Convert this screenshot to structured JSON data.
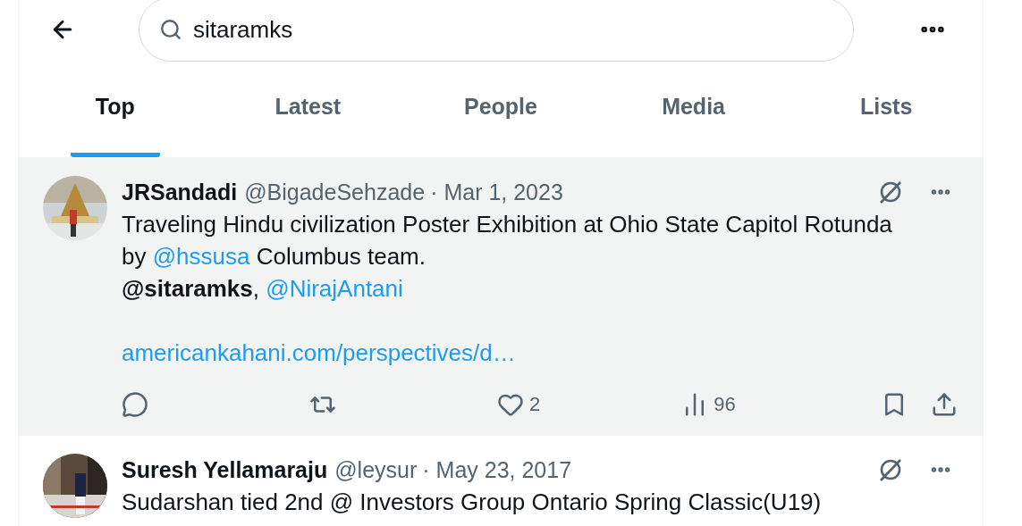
{
  "search": {
    "value": "sitaramks"
  },
  "tabs": [
    {
      "label": "Top",
      "selected": true
    },
    {
      "label": "Latest",
      "selected": false
    },
    {
      "label": "People",
      "selected": false
    },
    {
      "label": "Media",
      "selected": false
    },
    {
      "label": "Lists",
      "selected": false
    }
  ],
  "tweets": [
    {
      "name": "JRSandadi",
      "handle": "@BigadeSehzade",
      "date": "· Mar 1, 2023",
      "highlighted": true,
      "avatar": {
        "kind": "picture"
      },
      "body": [
        [
          [
            {
              "kind": "text",
              "text": "Traveling Hindu civilization Poster Exhibition at Ohio State Capitol Rotunda by "
            },
            {
              "kind": "link",
              "text": "@hssusa"
            },
            {
              "kind": "text",
              "text": " Columbus team."
            }
          ],
          [
            {
              "kind": "highlight",
              "text": "@sitaramks"
            },
            {
              "kind": "text",
              "text": ", "
            },
            {
              "kind": "link",
              "text": "@NirajAntani"
            }
          ]
        ],
        [
          [
            {
              "kind": "link",
              "text": "americankahani.com/perspectives/d…"
            }
          ]
        ]
      ],
      "actions": {
        "likes": "2",
        "views": "96"
      }
    },
    {
      "name": "Suresh Yellamaraju",
      "handle": "@leysur",
      "date": "· May 23, 2017",
      "highlighted": false,
      "avatar": {
        "kind": "picture"
      },
      "body": [
        [
          [
            {
              "kind": "text",
              "text": "Sudarshan tied 2nd @ Investors Group Ontario Spring Classic(U19)"
            }
          ]
        ]
      ]
    }
  ]
}
